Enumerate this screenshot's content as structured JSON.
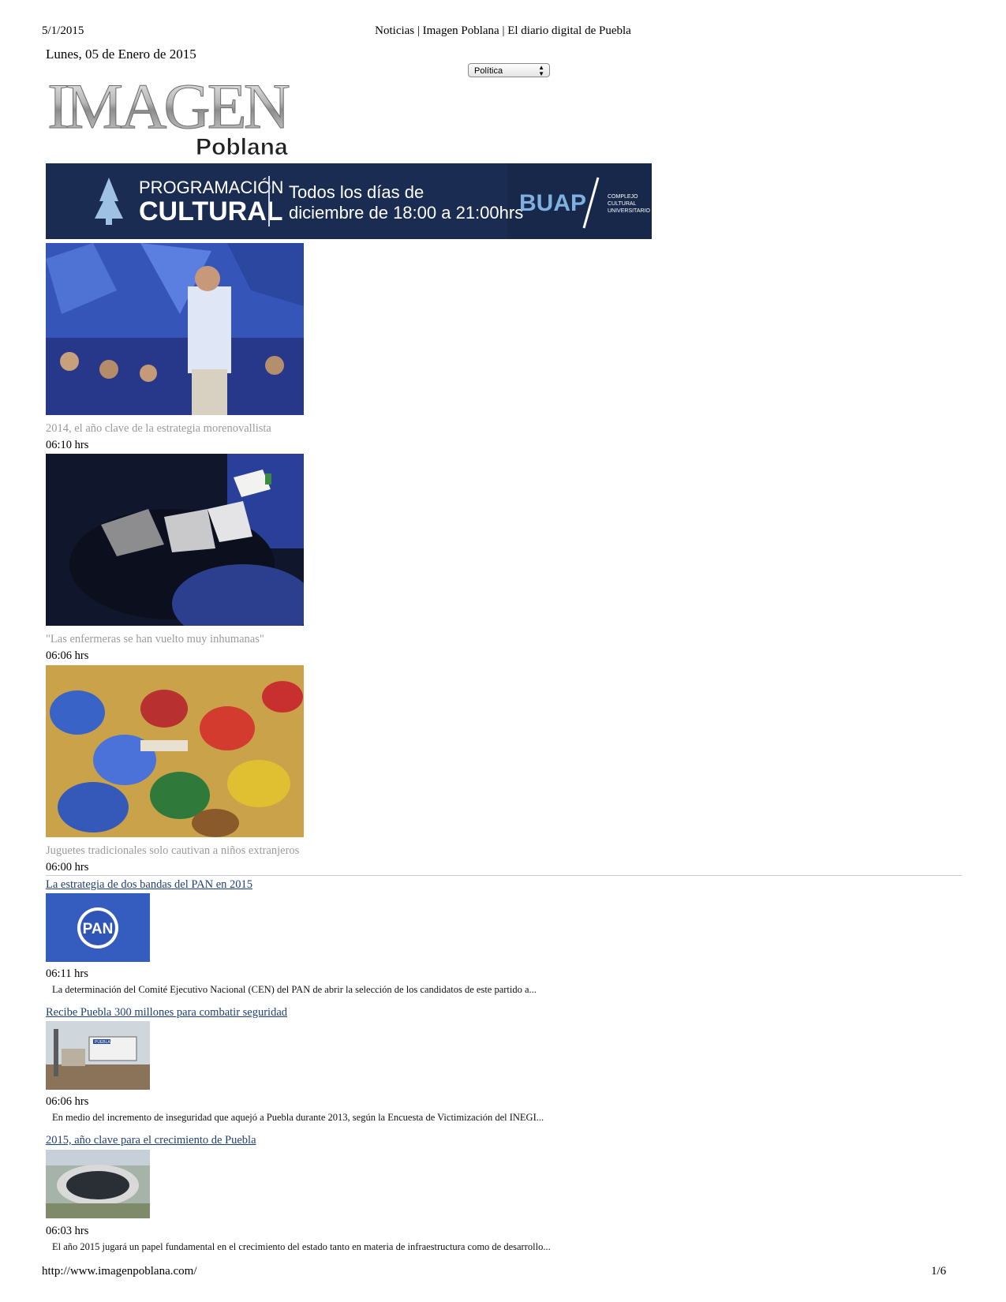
{
  "print_header": {
    "date": "5/1/2015",
    "title": "Noticias | Imagen Poblana | El diario digital de Puebla"
  },
  "site": {
    "current_date": "Lunes, 05 de Enero de 2015",
    "logo_text_main": "IMAGEN",
    "logo_text_sub": "Poblana",
    "section_select": "Política"
  },
  "banner": {
    "line1": "PROGRAMACIÓN",
    "line2": "CULTURAL",
    "schedule_line1": "Todos los días de",
    "schedule_line2": "diciembre de 18:00 a 21:00hrs",
    "brand": "BUAP",
    "brand_sub1": "COMPLEJO",
    "brand_sub2": "CULTURAL",
    "brand_sub3": "UNIVERSITARIO"
  },
  "featured": [
    {
      "caption": "2014, el año clave de la estrategia morenovallista",
      "time": "06:10 hrs"
    },
    {
      "caption": "\"Las enfermeras se han vuelto muy inhumanas\"",
      "time": "06:06 hrs"
    },
    {
      "caption": "Juguetes tradicionales solo cautivan a niños extranjeros",
      "time": "06:00 hrs"
    }
  ],
  "news": [
    {
      "title": "La estrategia de dos bandas del PAN en 2015",
      "time": "06:11 hrs",
      "summary": "La determinación del Comité Ejecutivo Nacional (CEN) del PAN de abrir la selección de los candidatos de este partido a...",
      "thumb_text": "PAN"
    },
    {
      "title": "Recibe Puebla 300 millones para combatir seguridad",
      "time": "06:06 hrs",
      "summary": "En medio del incremento de inseguridad que aquejó a Puebla durante 2013, según la Encuesta de Victimización del INEGI...",
      "thumb_text": "PUEBLA"
    },
    {
      "title": "2015, año clave para el crecimiento de Puebla",
      "time": "06:03 hrs",
      "summary": "El año 2015 jugará un papel fundamental en el crecimiento del estado tanto en materia de infraestructura como de desarrollo..."
    }
  ],
  "print_footer": {
    "url": "http://www.imagenpoblana.com/",
    "page": "1/6"
  }
}
